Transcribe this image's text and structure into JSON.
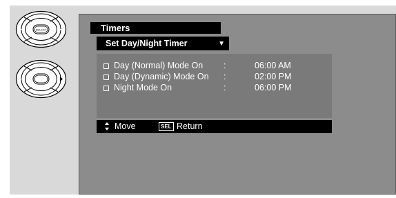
{
  "menu": {
    "title": "Timers",
    "selector": "Set Day/Night Timer",
    "items": [
      {
        "label": "Day (Normal) Mode On",
        "separator": ":",
        "time": "06:00 AM"
      },
      {
        "label": "Day (Dynamic) Mode On",
        "separator": ":",
        "time": "02:00 PM"
      },
      {
        "label": "Night Mode On",
        "separator": ":",
        "time": "06:00 PM"
      }
    ]
  },
  "hints": {
    "move": "Move",
    "sel_key": "SEL",
    "return": "Return"
  },
  "remote": {
    "select_label": "SELECT",
    "icons": [
      "select-button-icon",
      "right-arrow-button-icon"
    ]
  },
  "colors": {
    "background": "#d9d9d9",
    "screen": "#8c8c8c",
    "content_panel": "#7a7a7a",
    "bar": "#000000",
    "text": "#ffffff"
  }
}
